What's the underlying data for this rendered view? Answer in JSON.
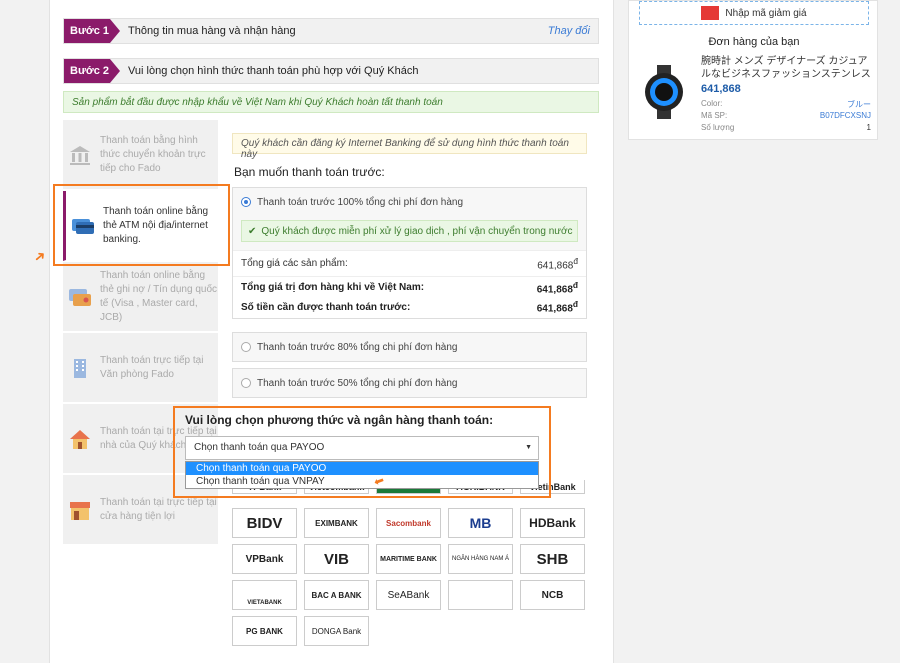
{
  "steps": [
    {
      "badge": "Bước 1",
      "title": "Thông tin mua hàng và nhận hàng",
      "link": "Thay đổi"
    },
    {
      "badge": "Bước 2",
      "title": "Vui lòng chọn hình thức thanh toán phù hợp với Quý Khách",
      "link": ""
    }
  ],
  "notice": "Sản phẩm bắt đầu được nhập khẩu về Việt Nam khi Quý Khách hoàn tất thanh toán",
  "methods": [
    {
      "label": "Thanh toán bằng hình thức chuyển khoản trực tiếp cho Fado",
      "icon": "bank-building-icon"
    },
    {
      "label": "Thanh toán online bằng thẻ ATM nội địa/internet banking.",
      "icon": "atm-card-icon"
    },
    {
      "label": "Thanh toán online bằng thẻ ghi nợ / Tín dụng quốc tế (Visa , Master card, JCB)",
      "icon": "credit-card-icon"
    },
    {
      "label": "Thanh toán trực tiếp tại Văn phòng Fado",
      "icon": "office-building-icon"
    },
    {
      "label": "Thanh toán tại trực tiếp tại nhà của Quý khách",
      "icon": "house-icon"
    },
    {
      "label": "Thanh toán tại trực tiếp tại cửa hàng tiện lợi",
      "icon": "store-icon"
    }
  ],
  "content": {
    "hint": "Quý khách cần đăng ký Internet Banking để sử dụng hình thức thanh toán này",
    "prepay_title": "Bạn muốn thanh toán trước:",
    "opt100": "Thanh toán trước 100% tổng chi phí đơn hàng",
    "free_note": "Quý khách được miễn phí xử lý giao dịch , phí vận chuyển trong nước",
    "total_products_label": "Tổng giá các sản phẩm:",
    "total_products_value": "641,868",
    "total_vn_label": "Tổng giá trị đơn hàng khi về Việt Nam:",
    "total_vn_value": "641,868",
    "prepay_amount_label": "Số tiền cần được thanh toán trước:",
    "prepay_amount_value": "641,868",
    "currency": "đ",
    "opt80": "Thanh toán trước 80% tổng chi phí đơn hàng",
    "opt50": "Thanh toán trước 50% tổng chi phí đơn hàng"
  },
  "bank_select": {
    "title": "Vui lòng chọn phương thức và ngân hàng thanh toán:",
    "selected": "Chọn thanh toán qua PAYOO",
    "options": [
      "Chọn thanh toán qua PAYOO",
      "Chọn thanh toán qua VNPAY"
    ]
  },
  "banks_partial": [
    "TPBank",
    "Vietcombank",
    "",
    "AGRIBANK",
    "VietinBank"
  ],
  "banks": [
    "BIDV",
    "EXIMBANK",
    "Sacombank",
    "MB",
    "HDBank",
    "VPBank",
    "VIB",
    "MARITIME BANK",
    "NGÂN HÀNG NAM Á",
    "SHB",
    "VIETABANK",
    "BAC A BANK",
    "SeABank",
    "",
    "NCB",
    "PG BANK",
    "DONGA Bank"
  ],
  "sidebar": {
    "coupon": "Nhập mã giảm giá",
    "order_title": "Đơn hàng của bạn",
    "product_name": "腕時計 メンズ デザイナーズ カジュアルなビジネスファッションステンレス",
    "product_price": "641,868",
    "color_label": "Color:",
    "color_value": "ブルー",
    "sku_label": "Mã SP:",
    "sku_value": "B07DFCXSNJ",
    "qty_label": "Số lượng",
    "qty_value": "1"
  },
  "colors": {
    "accent": "#8b1b6a",
    "highlight": "#f47b20",
    "link": "#3a7bd5",
    "price_red": "#d0021b"
  }
}
